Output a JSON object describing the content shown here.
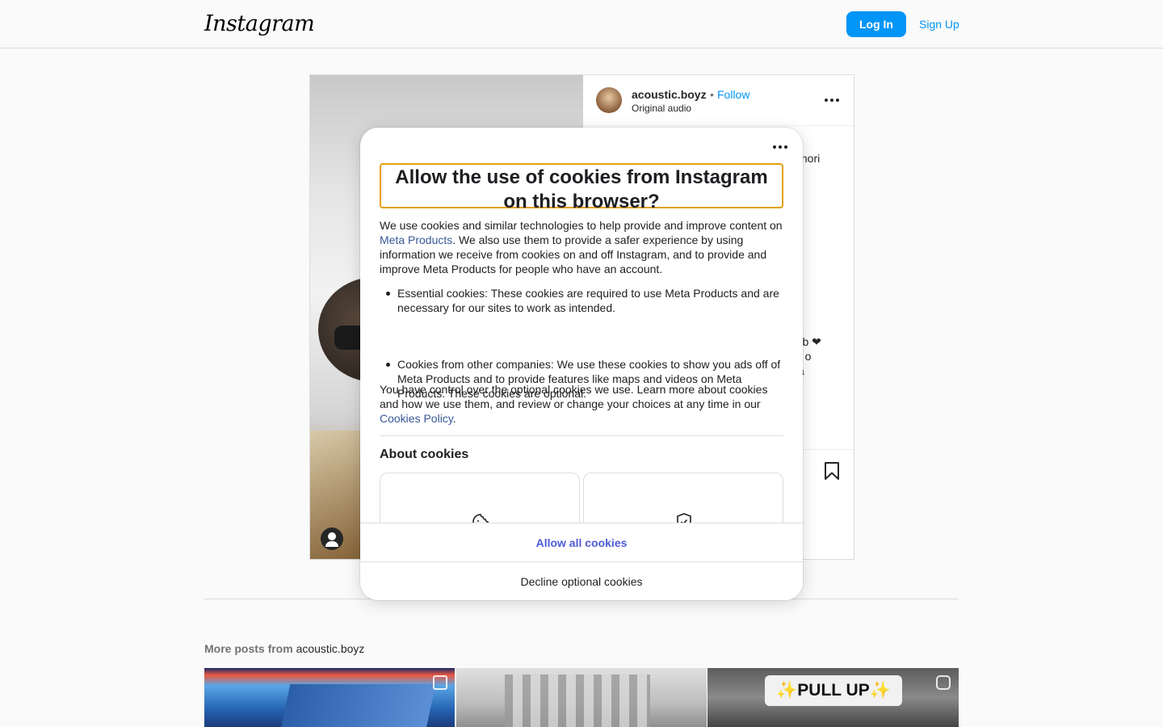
{
  "header": {
    "logo": "Instagram",
    "login_label": "Log In",
    "signup_label": "Sign Up"
  },
  "post": {
    "username": "acoustic.boyz",
    "separator": "•",
    "follow_label": "Follow",
    "audio": "Original audio",
    "caption_peek_1": "ignori",
    "caption_peek_2_lines": [
      "erb ❤",
      "tă o",
      "va"
    ]
  },
  "more_posts": {
    "prefix": "More posts from",
    "account": "acoustic.boyz",
    "tile3_text": "✨PULL UP✨"
  },
  "modal": {
    "title": "Allow the use of cookies from Instagram on this browser?",
    "intro_part1": "We use cookies and similar technologies to help provide and improve content on ",
    "intro_link": "Meta Products",
    "intro_part2": ". We also use them to provide a safer experience by using information we receive from cookies on and off Instagram, and to provide and improve Meta Products for people who have an account.",
    "list": [
      "Essential cookies: These cookies are required to use Meta Products and are necessary for our sites to work as intended.",
      "Cookies from other companies: We use these cookies to show you ads off of Meta Products and to provide features like maps and videos on Meta Products. These cookies are optional."
    ],
    "control_text": "You have control over the optional cookies we use. Learn more about cookies and how we use them, and review or change your choices at any time in our ",
    "control_link": "Cookies Policy",
    "control_end": ".",
    "about_title": "About cookies",
    "allow_label": "Allow all cookies",
    "decline_label": "Decline optional cookies"
  },
  "colors": {
    "accent": "#0095f6",
    "modal_button": "#4f5bd5",
    "link": "#385898",
    "focus_outline": "#e3a008"
  }
}
